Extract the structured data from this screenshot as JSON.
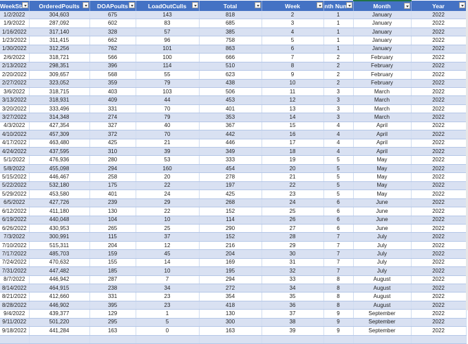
{
  "headers": [
    "WeekStart",
    "OrderedPoults",
    "DOAPoults",
    "LoadOutCulls",
    "Total",
    "Week",
    "Month Num",
    "Month",
    "Year"
  ],
  "rows": [
    [
      "1/2/2022",
      "304,603",
      "675",
      "143",
      "818",
      "2",
      "1",
      "January",
      "2022"
    ],
    [
      "1/9/2022",
      "287,092",
      "602",
      "83",
      "685",
      "3",
      "1",
      "January",
      "2022"
    ],
    [
      "1/16/2022",
      "317,140",
      "328",
      "57",
      "385",
      "4",
      "1",
      "January",
      "2022"
    ],
    [
      "1/23/2022",
      "311,415",
      "662",
      "96",
      "758",
      "5",
      "1",
      "January",
      "2022"
    ],
    [
      "1/30/2022",
      "312,256",
      "762",
      "101",
      "863",
      "6",
      "1",
      "January",
      "2022"
    ],
    [
      "2/6/2022",
      "318,721",
      "566",
      "100",
      "666",
      "7",
      "2",
      "February",
      "2022"
    ],
    [
      "2/13/2022",
      "298,351",
      "396",
      "114",
      "510",
      "8",
      "2",
      "February",
      "2022"
    ],
    [
      "2/20/2022",
      "309,657",
      "568",
      "55",
      "623",
      "9",
      "2",
      "February",
      "2022"
    ],
    [
      "2/27/2022",
      "323,052",
      "359",
      "79",
      "438",
      "10",
      "2",
      "February",
      "2022"
    ],
    [
      "3/6/2022",
      "318,715",
      "403",
      "103",
      "506",
      "11",
      "3",
      "March",
      "2022"
    ],
    [
      "3/13/2022",
      "318,931",
      "409",
      "44",
      "453",
      "12",
      "3",
      "March",
      "2022"
    ],
    [
      "3/20/2022",
      "333,496",
      "331",
      "70",
      "401",
      "13",
      "3",
      "March",
      "2022"
    ],
    [
      "3/27/2022",
      "314,348",
      "274",
      "79",
      "353",
      "14",
      "3",
      "March",
      "2022"
    ],
    [
      "4/3/2022",
      "427,354",
      "327",
      "40",
      "367",
      "15",
      "4",
      "April",
      "2022"
    ],
    [
      "4/10/2022",
      "457,309",
      "372",
      "70",
      "442",
      "16",
      "4",
      "April",
      "2022"
    ],
    [
      "4/17/2022",
      "463,480",
      "425",
      "21",
      "446",
      "17",
      "4",
      "April",
      "2022"
    ],
    [
      "4/24/2022",
      "437,595",
      "310",
      "39",
      "349",
      "18",
      "4",
      "April",
      "2022"
    ],
    [
      "5/1/2022",
      "476,936",
      "280",
      "53",
      "333",
      "19",
      "5",
      "May",
      "2022"
    ],
    [
      "5/8/2022",
      "455,098",
      "294",
      "160",
      "454",
      "20",
      "5",
      "May",
      "2022"
    ],
    [
      "5/15/2022",
      "446,467",
      "258",
      "20",
      "278",
      "21",
      "5",
      "May",
      "2022"
    ],
    [
      "5/22/2022",
      "532,180",
      "175",
      "22",
      "197",
      "22",
      "5",
      "May",
      "2022"
    ],
    [
      "5/29/2022",
      "453,580",
      "401",
      "24",
      "425",
      "23",
      "5",
      "May",
      "2022"
    ],
    [
      "6/5/2022",
      "427,726",
      "239",
      "29",
      "268",
      "24",
      "6",
      "June",
      "2022"
    ],
    [
      "6/12/2022",
      "411,180",
      "130",
      "22",
      "152",
      "25",
      "6",
      "June",
      "2022"
    ],
    [
      "6/19/2022",
      "440,048",
      "104",
      "10",
      "114",
      "26",
      "6",
      "June",
      "2022"
    ],
    [
      "6/26/2022",
      "430,953",
      "265",
      "25",
      "290",
      "27",
      "6",
      "June",
      "2022"
    ],
    [
      "7/3/2022",
      "300,991",
      "115",
      "37",
      "152",
      "28",
      "7",
      "July",
      "2022"
    ],
    [
      "7/10/2022",
      "515,311",
      "204",
      "12",
      "216",
      "29",
      "7",
      "July",
      "2022"
    ],
    [
      "7/17/2022",
      "485,703",
      "159",
      "45",
      "204",
      "30",
      "7",
      "July",
      "2022"
    ],
    [
      "7/24/2022",
      "470,632",
      "155",
      "14",
      "169",
      "31",
      "7",
      "July",
      "2022"
    ],
    [
      "7/31/2022",
      "447,482",
      "185",
      "10",
      "195",
      "32",
      "7",
      "July",
      "2022"
    ],
    [
      "8/7/2022",
      "446,942",
      "287",
      "7",
      "294",
      "33",
      "8",
      "August",
      "2022"
    ],
    [
      "8/14/2022",
      "464,915",
      "238",
      "34",
      "272",
      "34",
      "8",
      "August",
      "2022"
    ],
    [
      "8/21/2022",
      "412,660",
      "331",
      "23",
      "354",
      "35",
      "8",
      "August",
      "2022"
    ],
    [
      "8/28/2022",
      "446,902",
      "395",
      "23",
      "418",
      "36",
      "8",
      "August",
      "2022"
    ],
    [
      "9/4/2022",
      "439,377",
      "129",
      "1",
      "130",
      "37",
      "9",
      "September",
      "2022"
    ],
    [
      "9/11/2022",
      "501,220",
      "295",
      "5",
      "300",
      "38",
      "9",
      "September",
      "2022"
    ],
    [
      "9/18/2022",
      "441,284",
      "163",
      "0",
      "163",
      "39",
      "9",
      "September",
      "2022"
    ]
  ],
  "colors": {
    "header": "#4472C4",
    "band": "#D9E1F2"
  }
}
